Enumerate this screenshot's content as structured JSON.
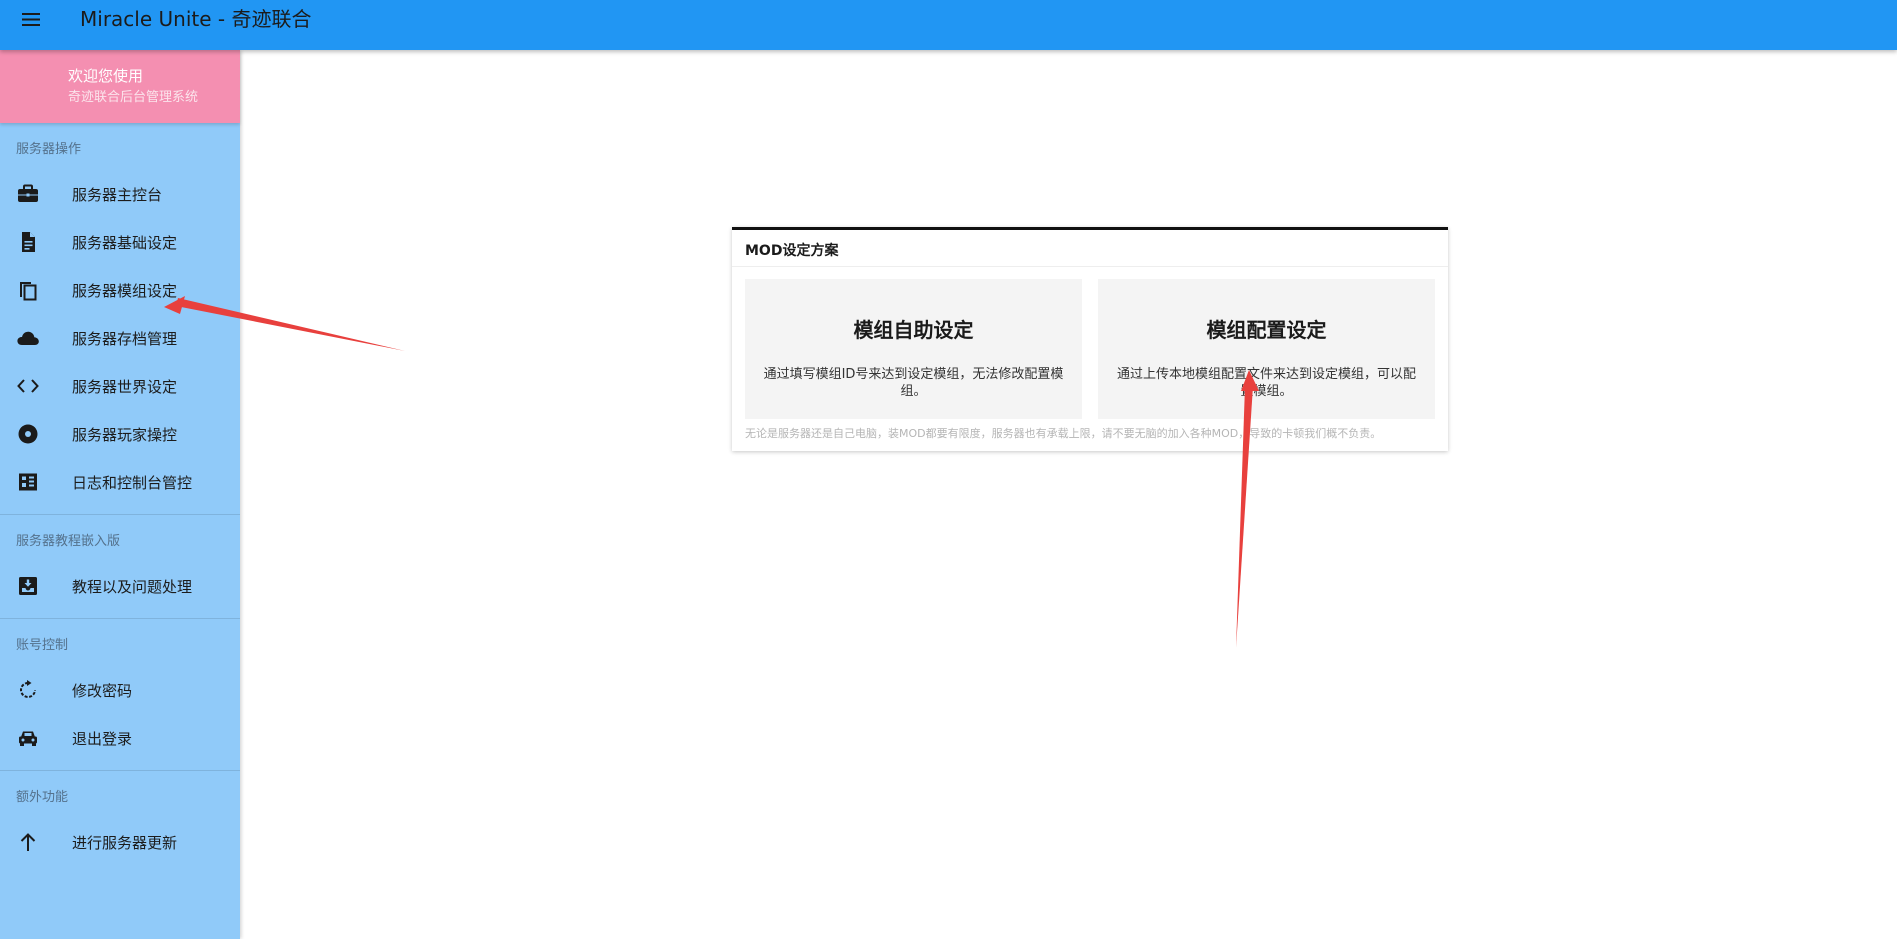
{
  "appbar": {
    "title": "Miracle Unite - 奇迹联合",
    "menu_icon": "menu-icon",
    "color": "#2196f3"
  },
  "sidebar": {
    "color": "#90caf9",
    "welcome": {
      "title": "欢迎您使用",
      "subtitle": "奇迹联合后台管理系统",
      "color": "#f48fb1"
    },
    "sections": [
      {
        "label": "服务器操作",
        "items": [
          {
            "label": "服务器主控台",
            "icon": "briefcase-icon"
          },
          {
            "label": "服务器基础设定",
            "icon": "document-icon"
          },
          {
            "label": "服务器模组设定",
            "icon": "copy-icon"
          },
          {
            "label": "服务器存档管理",
            "icon": "cloud-icon"
          },
          {
            "label": "服务器世界设定",
            "icon": "code-icon"
          },
          {
            "label": "服务器玩家操控",
            "icon": "disc-icon"
          },
          {
            "label": "日志和控制台管控",
            "icon": "memory-chip-icon"
          }
        ]
      },
      {
        "label": "服务器教程嵌入版",
        "items": [
          {
            "label": "教程以及问题处理",
            "icon": "inbox-download-icon"
          }
        ]
      },
      {
        "label": "账号控制",
        "items": [
          {
            "label": "修改密码",
            "icon": "rotate-icon"
          },
          {
            "label": "退出登录",
            "icon": "car-icon"
          }
        ]
      },
      {
        "label": "额外功能",
        "items": [
          {
            "label": "进行服务器更新",
            "icon": "arrow-up-icon"
          }
        ]
      }
    ]
  },
  "card": {
    "title": "MOD设定方案",
    "options": [
      {
        "title": "模组自助设定",
        "description": "通过填写模组ID号来达到设定模组，无法修改配置模组。"
      },
      {
        "title": "模组配置设定",
        "description": "通过上传本地模组配置文件来达到设定模组，可以配置模组。"
      }
    ],
    "note": "无论是服务器还是自己电脑，装MOD都要有限度，服务器也有承载上限，请不要无脑的加入各种MOD，导致的卡顿我们概不负责。"
  },
  "annotation_color": "#e8403d"
}
